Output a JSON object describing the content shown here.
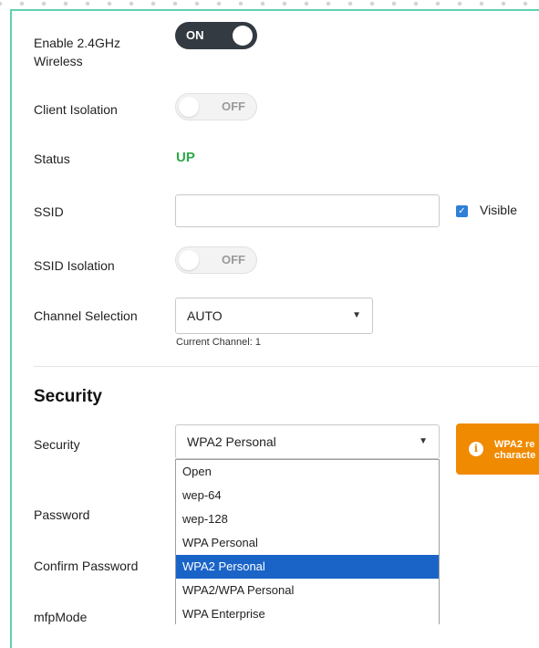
{
  "fields": {
    "enable_wireless": {
      "label": "Enable 2.4GHz Wireless",
      "state": "ON"
    },
    "client_isolation": {
      "label": "Client Isolation",
      "state": "OFF"
    },
    "status": {
      "label": "Status",
      "value": "UP",
      "color": "#2ea84a"
    },
    "ssid": {
      "label": "SSID",
      "value": "",
      "visible_label": "Visible",
      "visible_checked": true
    },
    "ssid_isolation": {
      "label": "SSID Isolation",
      "state": "OFF"
    },
    "channel": {
      "label": "Channel Selection",
      "value": "AUTO",
      "current": "Current Channel: 1"
    }
  },
  "security_section": {
    "title": "Security",
    "security_label": "Security",
    "security_value": "WPA2 Personal",
    "password_label": "Password",
    "confirm_password_label": "Confirm Password",
    "mfp_label": "mfpMode",
    "alert_text_line1": "WPA2 re",
    "alert_text_line2": "characte",
    "alert_color": "#f08a00",
    "options": [
      "Open",
      "wep-64",
      "wep-128",
      "WPA Personal",
      "WPA2 Personal",
      "WPA2/WPA Personal",
      "WPA Enterprise"
    ],
    "selected_option": "WPA2 Personal",
    "selected_color": "#1a64c8"
  },
  "icons": {
    "check": "checkmark-icon",
    "caret": "caret-down-icon",
    "info": "info-icon"
  }
}
